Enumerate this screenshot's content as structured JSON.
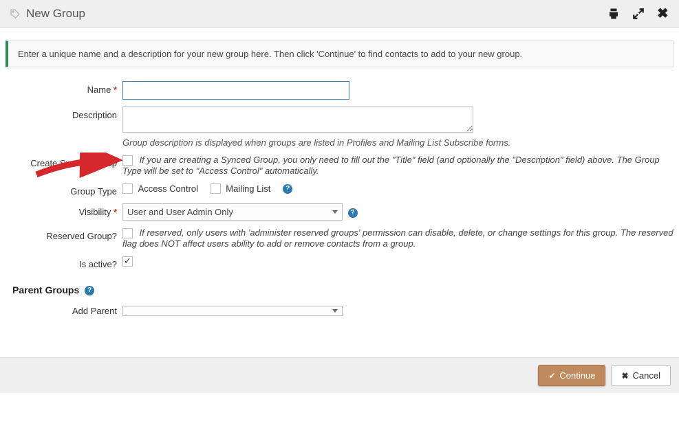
{
  "header": {
    "title": "New Group"
  },
  "banner": "Enter a unique name and a description for your new group here. Then click 'Continue' to find contacts to add to your new group.",
  "form": {
    "name": {
      "label": "Name",
      "value": ""
    },
    "description": {
      "label": "Description",
      "value": "",
      "help": "Group description is displayed when groups are listed in Profiles and Mailing List Subscribe forms."
    },
    "synced": {
      "label": "Create Synced Group",
      "note": "If you are creating a Synced Group, you only need to fill out the \"Title\" field (and optionally the \"Description\" field) above. The Group Type will be set to \"Access Control\" automatically."
    },
    "groupType": {
      "label": "Group Type",
      "options": {
        "access": "Access Control",
        "mailing": "Mailing List"
      }
    },
    "visibility": {
      "label": "Visibility",
      "selected": "User and User Admin Only"
    },
    "reserved": {
      "label": "Reserved Group?",
      "note": "If reserved, only users with 'administer reserved groups' permission can disable, delete, or change settings for this group. The reserved flag does NOT affect users ability to add or remove contacts from a group."
    },
    "active": {
      "label": "Is active?"
    }
  },
  "parents": {
    "heading": "Parent Groups",
    "addParent": {
      "label": "Add Parent",
      "selected": ""
    }
  },
  "footer": {
    "continue": "Continue",
    "cancel": "Cancel"
  }
}
